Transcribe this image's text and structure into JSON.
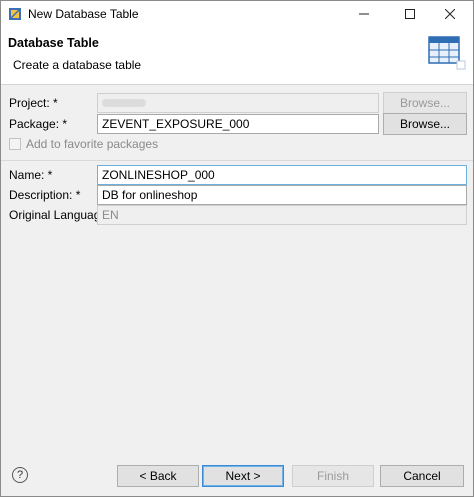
{
  "window": {
    "title": "New Database Table",
    "minimize_icon": "minimize-icon",
    "maximize_icon": "maximize-icon",
    "close_icon": "close-icon"
  },
  "header": {
    "title": "Database Table",
    "subtitle": "Create a database table",
    "icon": "table-icon"
  },
  "form": {
    "project": {
      "label": "Project: *",
      "value": "",
      "browse": "Browse..."
    },
    "package": {
      "label": "Package: *",
      "value": "ZEVENT_EXPOSURE_000",
      "browse": "Browse..."
    },
    "favorite": {
      "label": "Add to favorite packages"
    },
    "name": {
      "label": "Name: *",
      "value": "ZONLINESHOP_000"
    },
    "description": {
      "label": "Description: *",
      "value": "DB for onlineshop"
    },
    "original_language": {
      "label": "Original Language:",
      "value": "EN"
    }
  },
  "footer": {
    "help": "?",
    "back": "< Back",
    "next": "Next >",
    "finish": "Finish",
    "cancel": "Cancel"
  },
  "colors": {
    "accent": "#3a8ad8",
    "focus_border": "#6cb1e0",
    "window_bg": "#f0f0f0"
  }
}
